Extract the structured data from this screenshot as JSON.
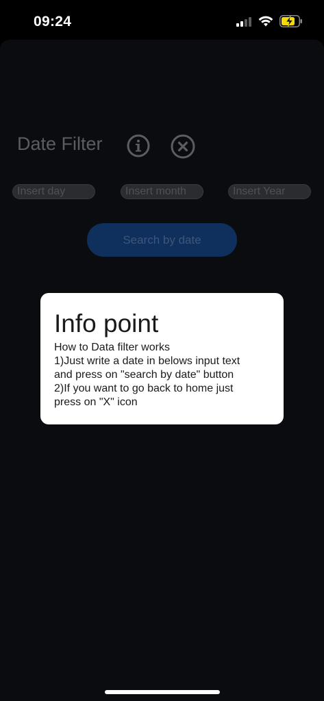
{
  "status_bar": {
    "time": "09:24"
  },
  "filter": {
    "title": "Date Filter",
    "info_icon": "info-icon",
    "close_icon": "close-icon",
    "day_placeholder": "Insert day",
    "month_placeholder": "Insert month",
    "year_placeholder": "Insert Year",
    "search_label": "Search by date"
  },
  "popup": {
    "title": "Info point",
    "lines": [
      "How to Data filter works",
      "1)Just write a date in belows input text",
      "and press on \"search by date\" button",
      "2)If you want to go back to home just",
      "press on \"X\" icon"
    ]
  },
  "colors": {
    "background": "#000000",
    "sheet": "#0b0c0f",
    "button": "#0f2f5c",
    "popup": "#ffffff",
    "battery_charging": "#f5d90a"
  }
}
